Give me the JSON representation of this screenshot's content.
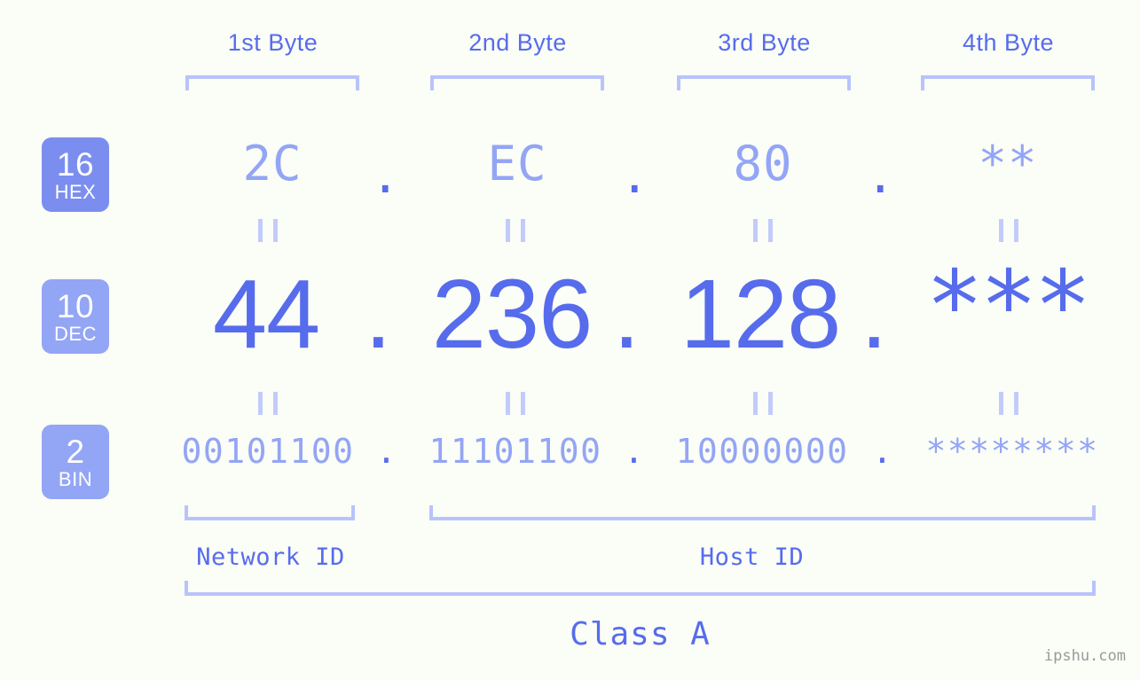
{
  "meta": {
    "background": "#fbfdf7",
    "accent_strong": "#566cec",
    "accent_mid": "#93a5f5",
    "accent_light": "#b9c3fb",
    "badge_hex_bg": "#7b8ef0",
    "badge_dec_bg": "#93a5f5",
    "badge_bin_bg": "#93a5f5"
  },
  "byte_headers": [
    {
      "label": "1st Byte"
    },
    {
      "label": "2nd Byte"
    },
    {
      "label": "3rd Byte"
    },
    {
      "label": "4th Byte"
    }
  ],
  "bases": [
    {
      "number": "16",
      "name": "HEX"
    },
    {
      "number": "10",
      "name": "DEC"
    },
    {
      "number": "2",
      "name": "BIN"
    }
  ],
  "rows": {
    "hex": {
      "base_number": "16",
      "base_name": "HEX",
      "values": [
        "2C",
        "EC",
        "80",
        "**"
      ],
      "separator": "."
    },
    "dec": {
      "base_number": "10",
      "base_name": "DEC",
      "values": [
        "44",
        "236",
        "128",
        "***"
      ],
      "separator": "."
    },
    "bin": {
      "base_number": "2",
      "base_name": "BIN",
      "values": [
        "00101100",
        "11101100",
        "10000000",
        "********"
      ],
      "separator": "."
    }
  },
  "separators": {
    "hex": [
      ".",
      ".",
      "."
    ],
    "dec": [
      ".",
      ".",
      "."
    ],
    "bin": [
      ".",
      ".",
      "."
    ]
  },
  "connectors": {
    "glyph": "||",
    "count_per_row": 4
  },
  "segments": {
    "network_id": "Network ID",
    "host_id": "Host ID",
    "class": "Class A"
  },
  "watermark": "ipshu.com"
}
